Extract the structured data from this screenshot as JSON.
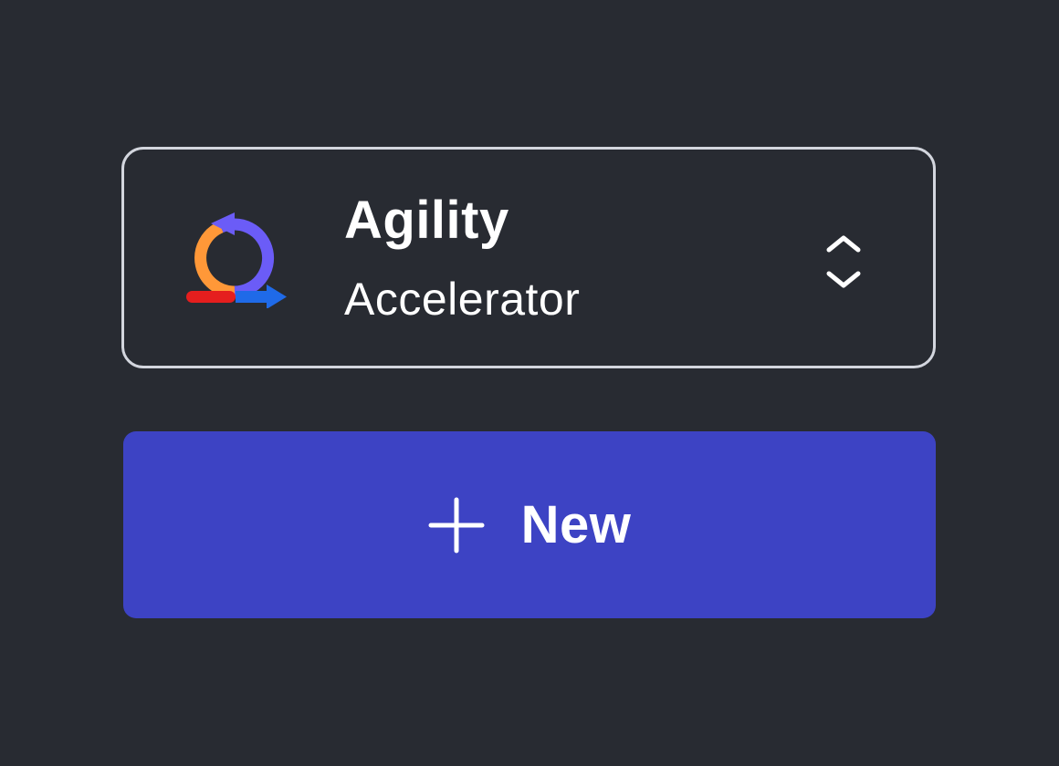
{
  "workspace_switcher": {
    "title": "Agility",
    "subtitle": "Accelerator",
    "logo_icon": "agility-cycle-logo-icon",
    "toggle_icon": "chevron-up-down-icon",
    "logo_colors": {
      "orange": "#ff9838",
      "purple": "#6b5cf7",
      "red": "#e51e1e",
      "blue": "#1f6ae8"
    }
  },
  "new_button": {
    "label": "New",
    "icon": "plus-icon",
    "background": "#3d43c4"
  },
  "colors": {
    "background": "#282b32",
    "border": "#d3d6de",
    "text": "#ffffff"
  }
}
